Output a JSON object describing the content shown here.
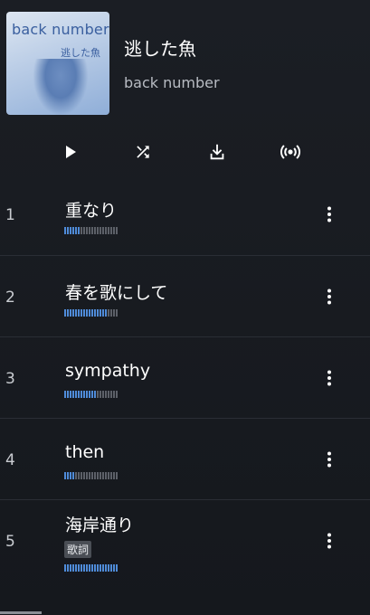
{
  "album": {
    "title": "逃した魚",
    "artist": "back number",
    "cover": {
      "artist_text": "back number",
      "title_text": "逃した魚"
    }
  },
  "controls": [
    {
      "name": "play-button",
      "icon": "play-icon"
    },
    {
      "name": "shuffle-button",
      "icon": "shuffle-icon"
    },
    {
      "name": "download-button",
      "icon": "download-icon"
    },
    {
      "name": "radio-button",
      "icon": "broadcast-icon"
    }
  ],
  "tracks": [
    {
      "number": "1",
      "title": "重なり",
      "lyrics_badge": "",
      "popularity": 0.28
    },
    {
      "number": "2",
      "title": "春を歌にして",
      "lyrics_badge": "",
      "popularity": 0.78
    },
    {
      "number": "3",
      "title": "sympathy",
      "lyrics_badge": "",
      "popularity": 0.58
    },
    {
      "number": "4",
      "title": "then",
      "lyrics_badge": "",
      "popularity": 0.22
    },
    {
      "number": "5",
      "title": "海岸通り",
      "lyrics_badge": "歌詞",
      "popularity": 1.0
    }
  ],
  "colors": {
    "background": "#1b1e24",
    "popularity_on": "#4f8bd8",
    "popularity_off": "#5c6068",
    "divider": "#2a2e35"
  }
}
